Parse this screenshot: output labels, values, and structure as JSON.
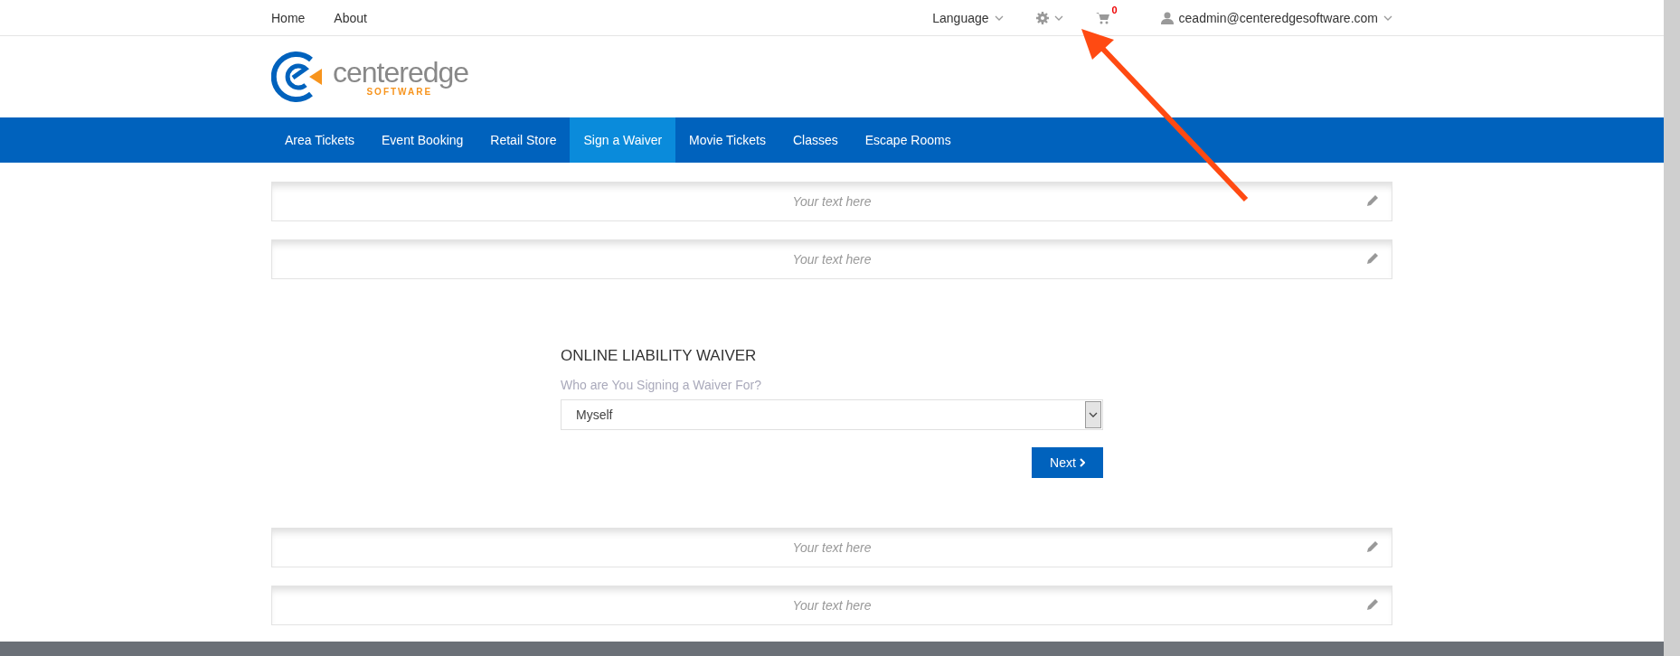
{
  "top_bar": {
    "links": [
      {
        "label": "Home"
      },
      {
        "label": "About"
      }
    ],
    "language": "Language",
    "cart_count": "0",
    "user": "ceadmin@centeredgesoftware.com"
  },
  "logo": {
    "name": "centeredge",
    "tagline": "SOFTWARE"
  },
  "nav": [
    {
      "label": "Area Tickets",
      "selected": false
    },
    {
      "label": "Event Booking",
      "selected": false
    },
    {
      "label": "Retail Store",
      "selected": false
    },
    {
      "label": "Sign a Waiver",
      "selected": true
    },
    {
      "label": "Movie Tickets",
      "selected": false
    },
    {
      "label": "Classes",
      "selected": false
    },
    {
      "label": "Escape Rooms",
      "selected": false
    }
  ],
  "top_text_blocks": [
    {
      "placeholder": "Your text here"
    },
    {
      "placeholder": "Your text here"
    }
  ],
  "form": {
    "title": "ONLINE LIABILITY WAIVER",
    "label": "Who are You Signing a Waiver For?",
    "value": "Myself",
    "button": "Next"
  },
  "bottom_text_blocks": [
    {
      "placeholder": "Your text here"
    },
    {
      "placeholder": "Your text here"
    }
  ]
}
